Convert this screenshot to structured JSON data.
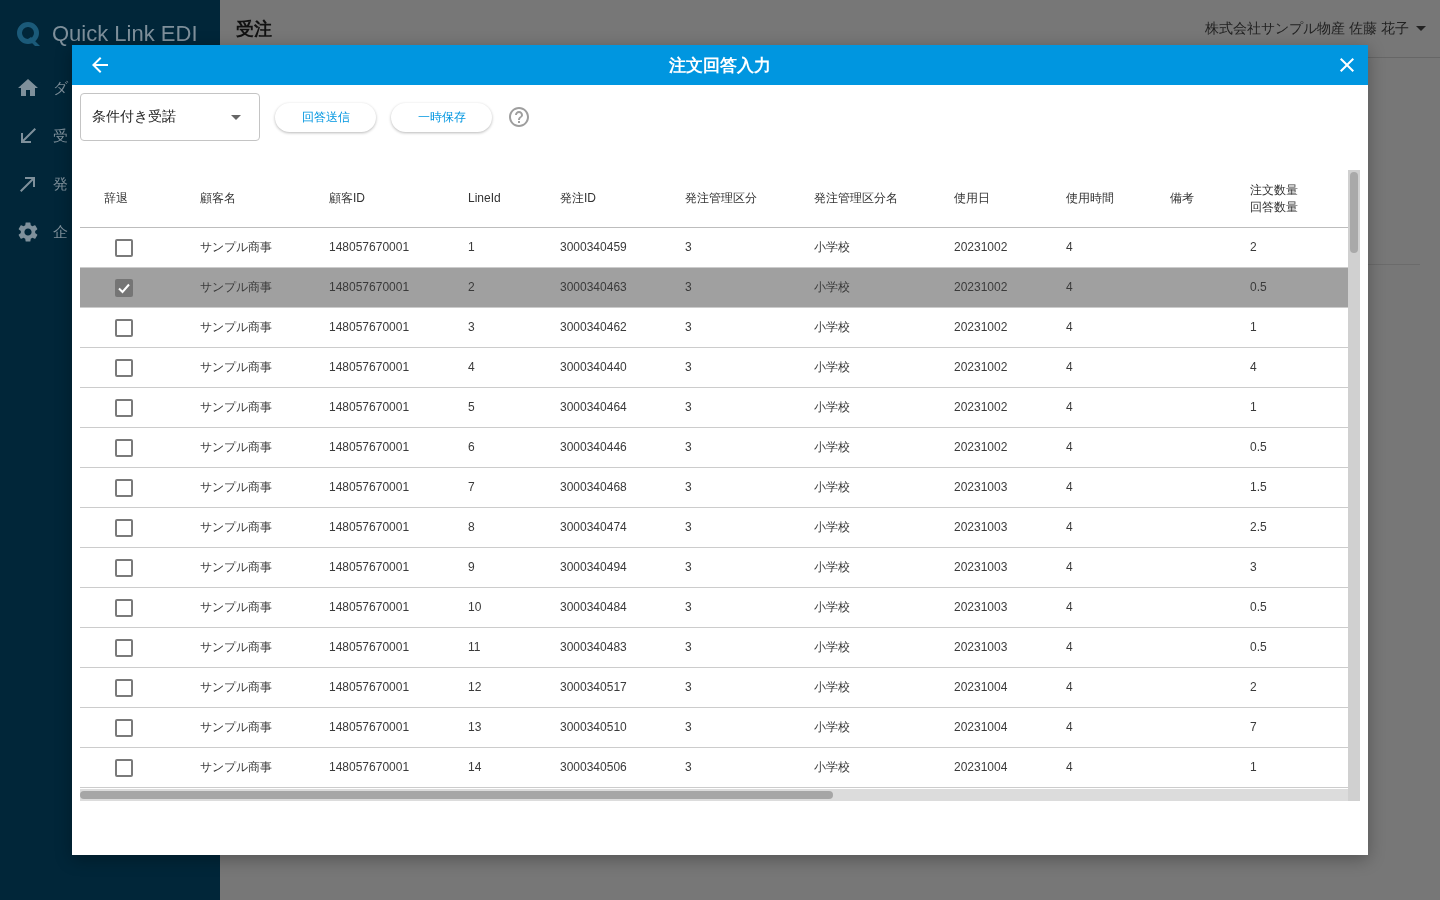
{
  "sidebar": {
    "logo": "Quick Link EDI",
    "items": [
      {
        "label": "ダ"
      },
      {
        "label": "受"
      },
      {
        "label": "発"
      },
      {
        "label": "企"
      }
    ]
  },
  "header": {
    "title": "受注",
    "user_menu": "株式会社サンプル物産 佐藤 花子"
  },
  "dialog": {
    "title": "注文回答入力",
    "response_select": {
      "value": "条件付き受諾"
    },
    "buttons": [
      "回答送信",
      "一時保存"
    ],
    "table": {
      "columns": [
        {
          "label": "辞退"
        },
        {
          "label": "顧客名"
        },
        {
          "label": "顧客ID"
        },
        {
          "label": "LineId"
        },
        {
          "label": "発注ID"
        },
        {
          "label": "発注管理区分"
        },
        {
          "label": "発注管理区分名"
        },
        {
          "label": "使用日"
        },
        {
          "label": "使用時間"
        },
        {
          "label": "備考"
        },
        {
          "label": "注文数量",
          "sublabel": "回答数量"
        }
      ],
      "rows": [
        {
          "checked": false,
          "selected": false,
          "customer_name": "サンプル商事",
          "customer_id": "148057670001",
          "line_id": "1",
          "order_id": "3000340459",
          "order_class": "3",
          "order_class_name": "小学校",
          "use_date": "20231002",
          "use_time": "4",
          "quantity": "2"
        },
        {
          "checked": true,
          "selected": true,
          "customer_name": "サンプル商事",
          "customer_id": "148057670001",
          "line_id": "2",
          "order_id": "3000340463",
          "order_class": "3",
          "order_class_name": "小学校",
          "use_date": "20231002",
          "use_time": "4",
          "quantity": "0.5"
        },
        {
          "checked": false,
          "selected": false,
          "customer_name": "サンプル商事",
          "customer_id": "148057670001",
          "line_id": "3",
          "order_id": "3000340462",
          "order_class": "3",
          "order_class_name": "小学校",
          "use_date": "20231002",
          "use_time": "4",
          "quantity": "1"
        },
        {
          "checked": false,
          "selected": false,
          "customer_name": "サンプル商事",
          "customer_id": "148057670001",
          "line_id": "4",
          "order_id": "3000340440",
          "order_class": "3",
          "order_class_name": "小学校",
          "use_date": "20231002",
          "use_time": "4",
          "quantity": "4"
        },
        {
          "checked": false,
          "selected": false,
          "customer_name": "サンプル商事",
          "customer_id": "148057670001",
          "line_id": "5",
          "order_id": "3000340464",
          "order_class": "3",
          "order_class_name": "小学校",
          "use_date": "20231002",
          "use_time": "4",
          "quantity": "1"
        },
        {
          "checked": false,
          "selected": false,
          "customer_name": "サンプル商事",
          "customer_id": "148057670001",
          "line_id": "6",
          "order_id": "3000340446",
          "order_class": "3",
          "order_class_name": "小学校",
          "use_date": "20231002",
          "use_time": "4",
          "quantity": "0.5"
        },
        {
          "checked": false,
          "selected": false,
          "customer_name": "サンプル商事",
          "customer_id": "148057670001",
          "line_id": "7",
          "order_id": "3000340468",
          "order_class": "3",
          "order_class_name": "小学校",
          "use_date": "20231003",
          "use_time": "4",
          "quantity": "1.5"
        },
        {
          "checked": false,
          "selected": false,
          "customer_name": "サンプル商事",
          "customer_id": "148057670001",
          "line_id": "8",
          "order_id": "3000340474",
          "order_class": "3",
          "order_class_name": "小学校",
          "use_date": "20231003",
          "use_time": "4",
          "quantity": "2.5"
        },
        {
          "checked": false,
          "selected": false,
          "customer_name": "サンプル商事",
          "customer_id": "148057670001",
          "line_id": "9",
          "order_id": "3000340494",
          "order_class": "3",
          "order_class_name": "小学校",
          "use_date": "20231003",
          "use_time": "4",
          "quantity": "3"
        },
        {
          "checked": false,
          "selected": false,
          "customer_name": "サンプル商事",
          "customer_id": "148057670001",
          "line_id": "10",
          "order_id": "3000340484",
          "order_class": "3",
          "order_class_name": "小学校",
          "use_date": "20231003",
          "use_time": "4",
          "quantity": "0.5"
        },
        {
          "checked": false,
          "selected": false,
          "customer_name": "サンプル商事",
          "customer_id": "148057670001",
          "line_id": "11",
          "order_id": "3000340483",
          "order_class": "3",
          "order_class_name": "小学校",
          "use_date": "20231003",
          "use_time": "4",
          "quantity": "0.5"
        },
        {
          "checked": false,
          "selected": false,
          "customer_name": "サンプル商事",
          "customer_id": "148057670001",
          "line_id": "12",
          "order_id": "3000340517",
          "order_class": "3",
          "order_class_name": "小学校",
          "use_date": "20231004",
          "use_time": "4",
          "quantity": "2"
        },
        {
          "checked": false,
          "selected": false,
          "customer_name": "サンプル商事",
          "customer_id": "148057670001",
          "line_id": "13",
          "order_id": "3000340510",
          "order_class": "3",
          "order_class_name": "小学校",
          "use_date": "20231004",
          "use_time": "4",
          "quantity": "7"
        },
        {
          "checked": false,
          "selected": false,
          "customer_name": "サンプル商事",
          "customer_id": "148057670001",
          "line_id": "14",
          "order_id": "3000340506",
          "order_class": "3",
          "order_class_name": "小学校",
          "use_date": "20231004",
          "use_time": "4",
          "quantity": "1"
        }
      ]
    }
  }
}
